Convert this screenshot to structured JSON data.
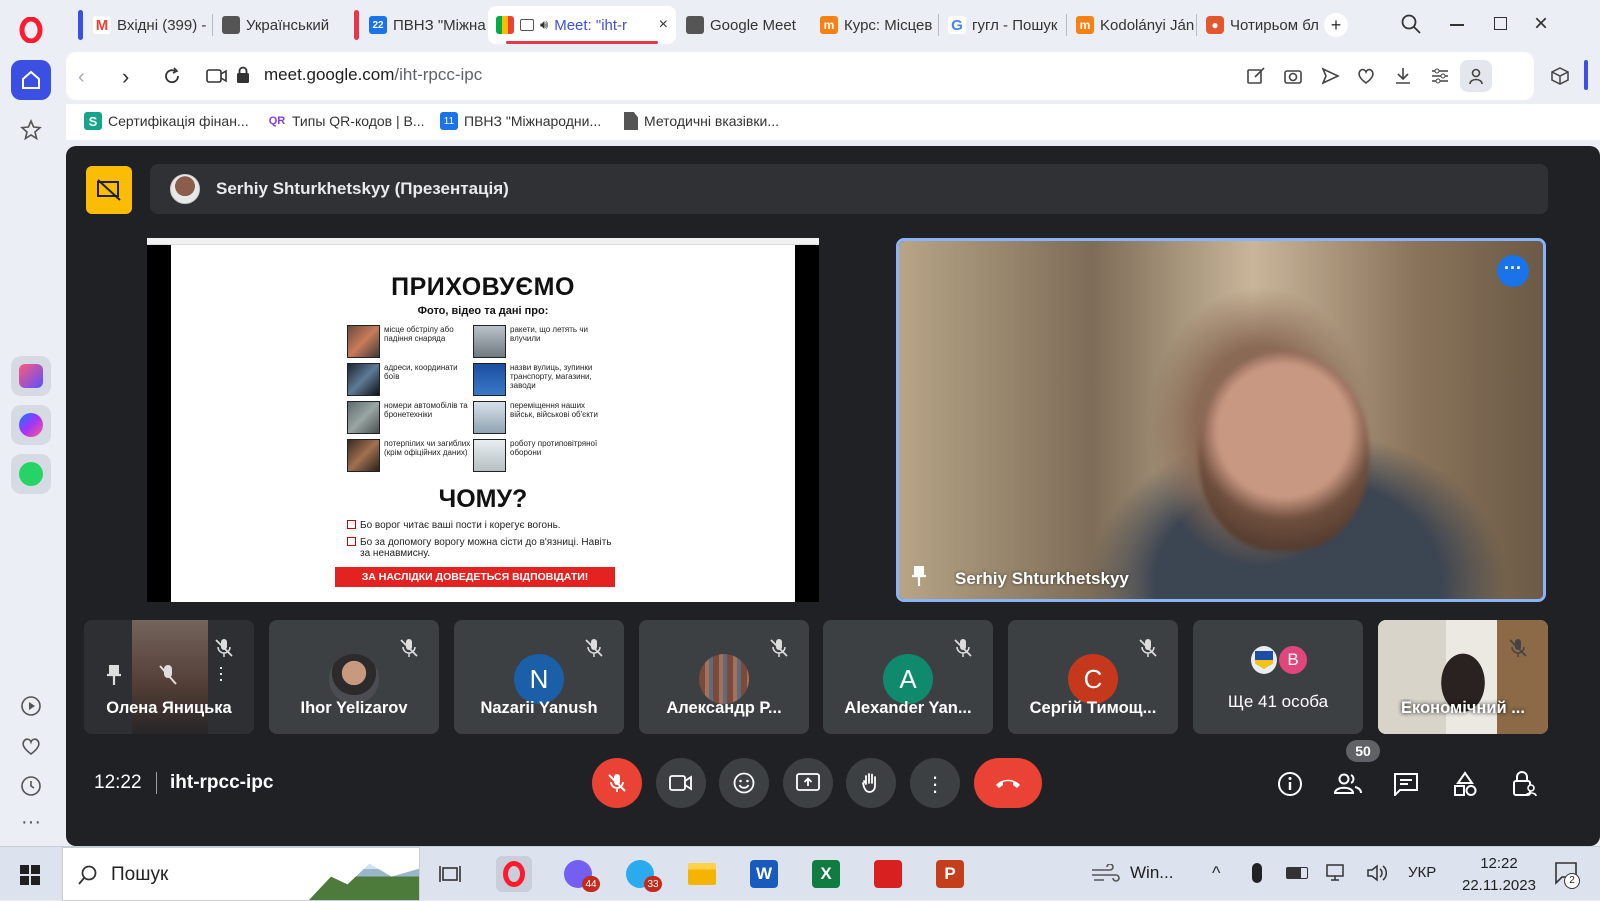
{
  "browser": {
    "tabs": [
      {
        "title": "Вхідні (399) -",
        "icon": "gmail-icon"
      },
      {
        "title": "Український",
        "icon": "doc-icon"
      },
      {
        "title": "ПВНЗ \"Міжна",
        "icon": "calendar-icon"
      },
      {
        "title": "Meet: \"iht-r",
        "icon": "meet-icon"
      },
      {
        "title": "Google Meet",
        "icon": "doc-icon"
      },
      {
        "title": "Курс: Місцев",
        "icon": "moodle-icon"
      },
      {
        "title": "гугл - Пошук",
        "icon": "google-icon"
      },
      {
        "title": "Kodolányi Ján",
        "icon": "moodle-icon"
      },
      {
        "title": "Чотирьом бл",
        "icon": "tab-app-icon"
      }
    ],
    "address": {
      "domain": "meet.google.com",
      "path": "/iht-rpcc-ipc"
    },
    "bookmarks": [
      {
        "label": "Сертифікація фінан...",
        "icon": "cert-icon"
      },
      {
        "label": "Типы QR-кодов | В...",
        "icon": "qr-icon"
      },
      {
        "label": "ПВНЗ \"Міжнародни...",
        "icon": "calendar-icon"
      },
      {
        "label": "Методичні вказівки...",
        "icon": "doc-icon"
      }
    ]
  },
  "meet": {
    "presenter_bar": "Serhiy Shturkhetskyy (Презентація)",
    "slide": {
      "title": "ПРИХОВУЄМО",
      "subtitle": "Фото, відео та дані про:",
      "items_left": [
        "місце обстрілу або падіння снаряда",
        "адреси, координати боїв",
        "номери автомобілів та бронетехніки",
        "потерпілих чи загиблих (крім офіційних даних)"
      ],
      "items_right": [
        "ракети, що летять чи влучили",
        "назви вулиць, зупинки транспорту, магазини, заводи",
        "переміщення наших військ, військові об'єкти",
        "роботу протиповітряної оборони"
      ],
      "why": "ЧОМУ?",
      "reasons": [
        "Бо ворог читає ваші пости і корегує вогонь.",
        "Бо за допомогу ворогу можна сісти до в'язниці. Навіть за ненавмисну."
      ],
      "banner": "ЗА НАСЛІДКИ ДОВЕДЕТЬСЯ ВІДПОВІДАТИ!"
    },
    "speaker_name": "Serhiy Shturkhetskyy",
    "participants": [
      {
        "name": "Олена Яницька",
        "avatar": "photo"
      },
      {
        "name": "Ihor Yelizarov",
        "avatar": "photo"
      },
      {
        "name": "Nazarii Yanush",
        "avatar": "letter",
        "letter": "N",
        "color": "#1a5fa8"
      },
      {
        "name": "Александр Р...",
        "avatar": "photo"
      },
      {
        "name": "Alexander Yan...",
        "avatar": "letter",
        "letter": "A",
        "color": "#0f8a6c"
      },
      {
        "name": "Сергій Тимощ...",
        "avatar": "letter",
        "letter": "С",
        "color": "#c5381c"
      },
      {
        "name": "Ще 41 особа",
        "avatar": "group",
        "letter": "B",
        "color": "#e0457b"
      },
      {
        "name": "Економічний ...",
        "avatar": "video"
      }
    ],
    "time": "12:22",
    "meeting_code": "iht-rpcc-ipc",
    "people_count": "50"
  },
  "taskbar": {
    "search_placeholder": "Пошук",
    "badges": {
      "viber": "44",
      "telegram": "33"
    },
    "weather": "Win...",
    "lang": "УКР",
    "time": "12:22",
    "date": "22.11.2023",
    "notifications": "2"
  }
}
